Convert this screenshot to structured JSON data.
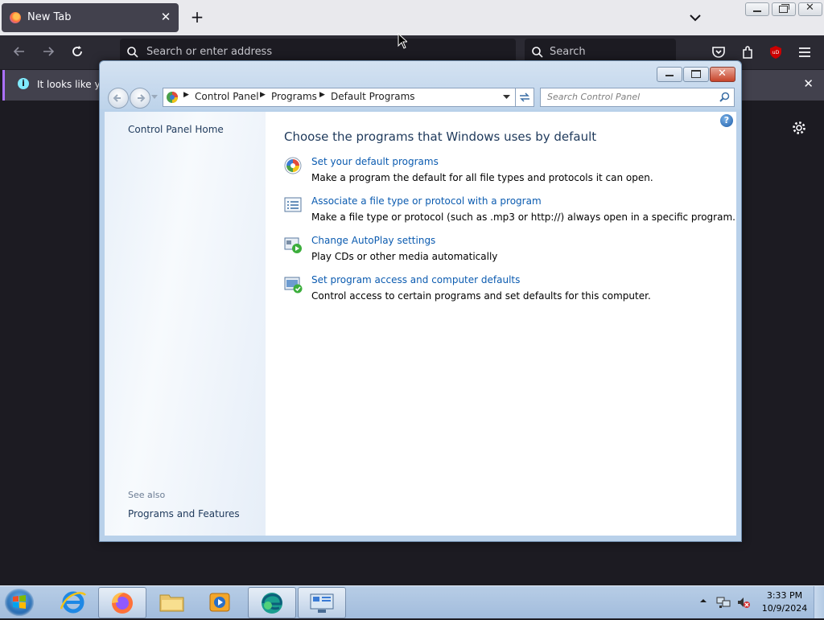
{
  "browser": {
    "tab_title": "New Tab",
    "new_tab_symbol": "+",
    "close_symbol": "✕",
    "url_placeholder": "Search or enter address",
    "search_placeholder": "Search",
    "info_bar_text": "It looks like you",
    "info_close": "✕",
    "icons": [
      "back-icon",
      "forward-icon",
      "reload-icon",
      "pocket-icon",
      "extensions-icon",
      "ublock-icon",
      "menu-icon",
      "gear-icon",
      "list-all-tabs-icon"
    ]
  },
  "control_panel": {
    "breadcrumb": [
      "Control Panel",
      "Programs",
      "Default Programs"
    ],
    "search_placeholder": "Search Control Panel",
    "left": {
      "home": "Control Panel Home",
      "see_also": "See also",
      "programs_features": "Programs and Features"
    },
    "main": {
      "heading": "Choose the programs that Windows uses by default",
      "tasks": [
        {
          "link": "Set your default programs",
          "desc": "Make a program the default for all file types and protocols it can open."
        },
        {
          "link": "Associate a file type or protocol with a program",
          "desc": "Make a file type or protocol (such as .mp3 or http://) always open in a specific program."
        },
        {
          "link": "Change AutoPlay settings",
          "desc": "Play CDs or other media automatically"
        },
        {
          "link": "Set program access and computer defaults",
          "desc": "Control access to certain programs and set defaults for this computer."
        }
      ]
    }
  },
  "taskbar": {
    "time": "3:33 PM",
    "date": "10/9/2024",
    "pinned": [
      "internet-explorer-icon",
      "firefox-icon",
      "explorer-icon",
      "media-player-icon",
      "edge-icon",
      "control-panel-icon"
    ]
  },
  "colors": {
    "firefox_dark": "#2b2a33",
    "link_blue": "#0b5bb0",
    "heading_blue": "#1e395b",
    "taskbar": "#a2bcdc"
  }
}
